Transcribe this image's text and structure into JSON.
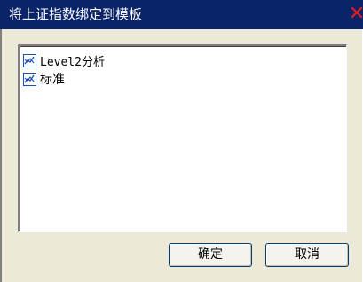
{
  "window": {
    "title": "将上证指数绑定到模板"
  },
  "templates": [
    {
      "label": "Level2分析",
      "icon": "chart-icon"
    },
    {
      "label": "标准",
      "icon": "chart-icon"
    }
  ],
  "buttons": {
    "ok_label": "确定",
    "cancel_label": "取消"
  },
  "colors": {
    "titlebar": "#0a246a",
    "close": "#e81c1c",
    "dialog_bg": "#ece9d8",
    "list_bg": "#ffffff"
  }
}
